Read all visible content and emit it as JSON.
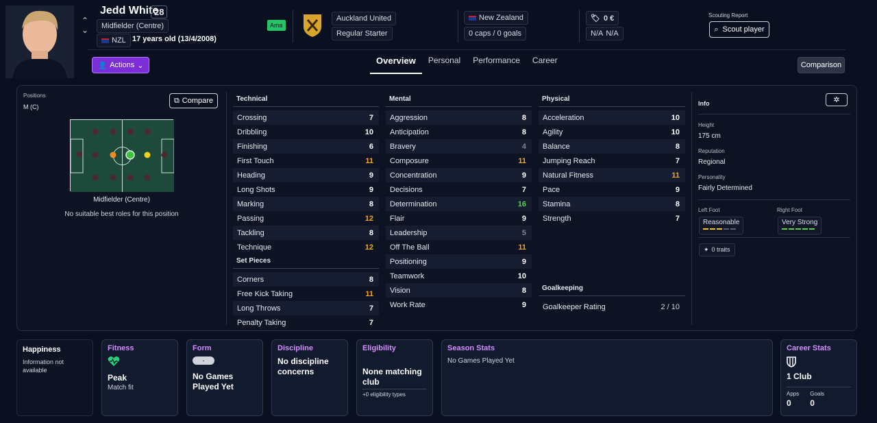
{
  "player": {
    "name": "Jedd White",
    "number": "28",
    "position": "Midfielder (Centre)",
    "nationality_code": "NZL",
    "age_line": "17 years old (13/4/2008)",
    "status_badge": "Ama"
  },
  "club": {
    "name": "Auckland United",
    "role": "Regular Starter"
  },
  "nation": {
    "name": "New Zealand",
    "caps": "0 caps / 0 goals"
  },
  "value": {
    "amount": "0 €",
    "wage": "N/A",
    "wage2": "N/A"
  },
  "scouting": {
    "title": "Scouting Report",
    "button": "Scout player"
  },
  "actions_label": "Actions",
  "tabs": [
    "Overview",
    "Personal",
    "Performance",
    "Career"
  ],
  "comparison_label": "Comparison",
  "positions": {
    "label": "Positions",
    "value": "M (C)",
    "compare": "Compare",
    "role_name": "Midfielder (Centre)",
    "role_note": "No suitable best roles for this position"
  },
  "technical": {
    "title": "Technical",
    "rows": [
      {
        "n": "Crossing",
        "v": "7",
        "c": ""
      },
      {
        "n": "Dribbling",
        "v": "10",
        "c": ""
      },
      {
        "n": "Finishing",
        "v": "6",
        "c": ""
      },
      {
        "n": "First Touch",
        "v": "11",
        "c": "orange"
      },
      {
        "n": "Heading",
        "v": "9",
        "c": ""
      },
      {
        "n": "Long Shots",
        "v": "9",
        "c": ""
      },
      {
        "n": "Marking",
        "v": "8",
        "c": ""
      },
      {
        "n": "Passing",
        "v": "12",
        "c": "orange"
      },
      {
        "n": "Tackling",
        "v": "8",
        "c": ""
      },
      {
        "n": "Technique",
        "v": "12",
        "c": "orange"
      }
    ]
  },
  "set_pieces": {
    "title": "Set Pieces",
    "rows": [
      {
        "n": "Corners",
        "v": "8",
        "c": ""
      },
      {
        "n": "Free Kick Taking",
        "v": "11",
        "c": "orange"
      },
      {
        "n": "Long Throws",
        "v": "7",
        "c": ""
      },
      {
        "n": "Penalty Taking",
        "v": "7",
        "c": ""
      }
    ]
  },
  "mental": {
    "title": "Mental",
    "rows": [
      {
        "n": "Aggression",
        "v": "8",
        "c": ""
      },
      {
        "n": "Anticipation",
        "v": "8",
        "c": ""
      },
      {
        "n": "Bravery",
        "v": "4",
        "c": "gray"
      },
      {
        "n": "Composure",
        "v": "11",
        "c": "orange"
      },
      {
        "n": "Concentration",
        "v": "9",
        "c": ""
      },
      {
        "n": "Decisions",
        "v": "7",
        "c": ""
      },
      {
        "n": "Determination",
        "v": "16",
        "c": "green"
      },
      {
        "n": "Flair",
        "v": "9",
        "c": ""
      },
      {
        "n": "Leadership",
        "v": "5",
        "c": "gray"
      },
      {
        "n": "Off The Ball",
        "v": "11",
        "c": "orange"
      },
      {
        "n": "Positioning",
        "v": "9",
        "c": ""
      },
      {
        "n": "Teamwork",
        "v": "10",
        "c": ""
      },
      {
        "n": "Vision",
        "v": "8",
        "c": ""
      },
      {
        "n": "Work Rate",
        "v": "9",
        "c": ""
      }
    ]
  },
  "physical": {
    "title": "Physical",
    "rows": [
      {
        "n": "Acceleration",
        "v": "10",
        "c": ""
      },
      {
        "n": "Agility",
        "v": "10",
        "c": ""
      },
      {
        "n": "Balance",
        "v": "8",
        "c": ""
      },
      {
        "n": "Jumping Reach",
        "v": "7",
        "c": ""
      },
      {
        "n": "Natural Fitness",
        "v": "11",
        "c": "orange"
      },
      {
        "n": "Pace",
        "v": "9",
        "c": ""
      },
      {
        "n": "Stamina",
        "v": "8",
        "c": ""
      },
      {
        "n": "Strength",
        "v": "7",
        "c": ""
      }
    ]
  },
  "goalkeeping": {
    "title": "Goalkeeping",
    "label": "Goalkeeper Rating",
    "value": "2 / 10"
  },
  "info": {
    "title": "Info",
    "height_label": "Height",
    "height": "175 cm",
    "reputation_label": "Reputation",
    "reputation": "Regional",
    "personality_label": "Personality",
    "personality": "Fairly Determined",
    "left_foot_label": "Left Foot",
    "left_foot": "Reasonable",
    "right_foot_label": "Right Foot",
    "right_foot": "Very Strong",
    "traits": "0 traits"
  },
  "cards": {
    "happiness": {
      "title": "Happiness",
      "text": "Information not available"
    },
    "fitness": {
      "title": "Fitness",
      "value": "Peak",
      "sub": "Match fit"
    },
    "form": {
      "title": "Form",
      "chip": "-",
      "value": "No Games Played Yet"
    },
    "discipline": {
      "title": "Discipline",
      "value": "No discipline concerns"
    },
    "eligibility": {
      "title": "Eligibility",
      "value": "None matching club",
      "sub": "+0 eligibility types"
    },
    "season": {
      "title": "Season Stats",
      "text": "No Games Played Yet"
    },
    "career": {
      "title": "Career Stats",
      "value": "1 Club",
      "apps_label": "Apps",
      "apps": "0",
      "goals_label": "Goals",
      "goals": "0"
    }
  },
  "colors": {
    "accent": "#7b2ed8",
    "attr_good": "#f5a623",
    "attr_great": "#53d646",
    "card_title": "#d48cff"
  }
}
